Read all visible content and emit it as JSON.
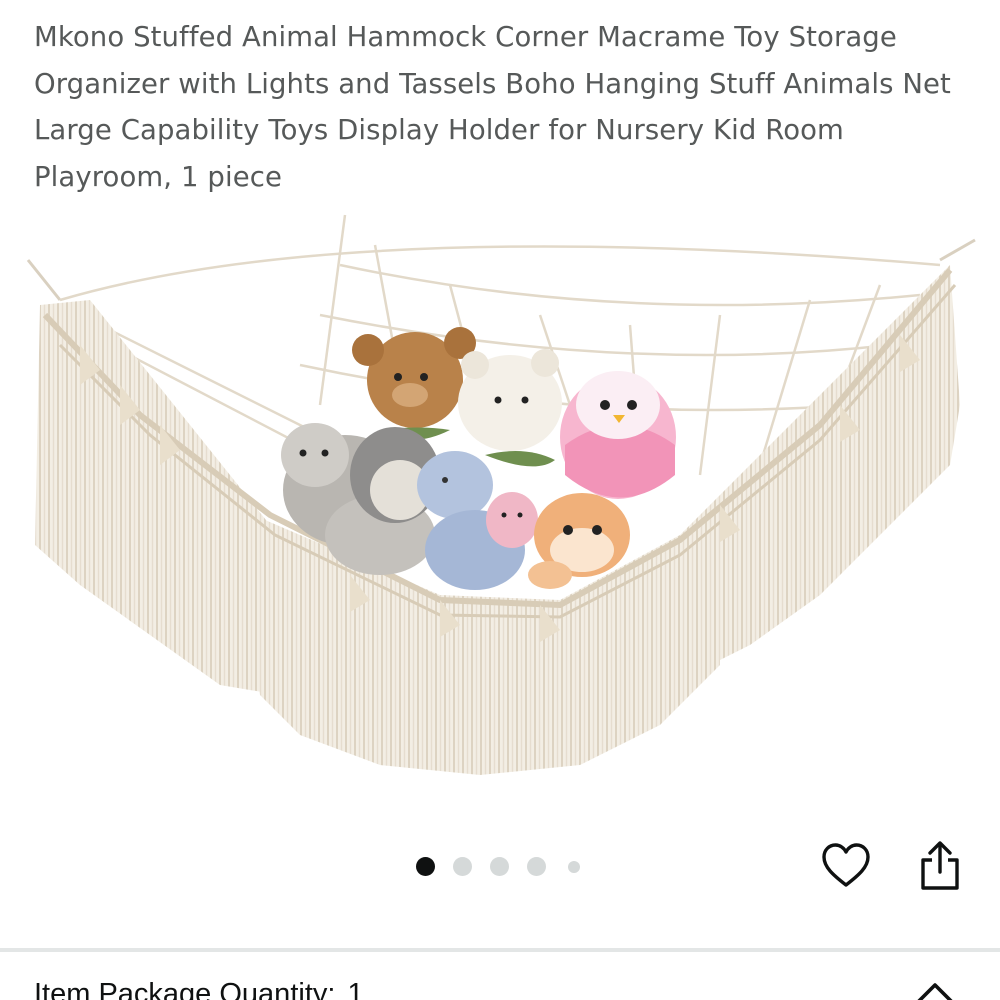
{
  "product": {
    "title": "Mkono Stuffed Animal Hammock Corner Macrame Toy Storage Organizer with Lights and Tassels Boho Hanging Stuff Animals Net Large Capability Toys Display Holder for Nursery Kid Room Playroom, 1 piece"
  },
  "carousel": {
    "total_images": 5,
    "active_index": 0
  },
  "actions": {
    "favorite_icon": "heart-outline-icon",
    "share_icon": "share-icon"
  },
  "quantity": {
    "label": "Item Package Quantity:",
    "value": "1",
    "toggle_icon": "chevron-up-icon"
  },
  "colors": {
    "text_primary": "#0f1111",
    "text_secondary": "#565959",
    "dot_active": "#0f1111",
    "dot_inactive": "#d5d9d9",
    "divider": "#e3e6e6",
    "macrame": "#efe8dc"
  }
}
